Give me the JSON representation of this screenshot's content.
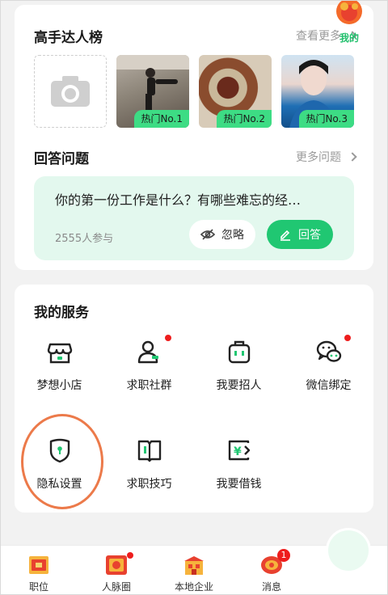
{
  "talent_ranking": {
    "title": "高手达人榜",
    "more_label": "查看更多",
    "items": [
      {
        "badge": "热门No.1"
      },
      {
        "badge": "热门No.2"
      },
      {
        "badge": "热门No.3"
      }
    ]
  },
  "questions": {
    "title": "回答问题",
    "more_label": "更多问题",
    "question": "你的第一份工作是什么？有哪些难忘的经…",
    "participants": "2555人参与",
    "ignore_label": "忽略",
    "answer_label": "回答"
  },
  "services": {
    "title": "我的服务",
    "items": [
      {
        "label": "梦想小店",
        "icon": "shop-icon"
      },
      {
        "label": "求职社群",
        "icon": "community-icon"
      },
      {
        "label": "我要招人",
        "icon": "recruit-icon"
      },
      {
        "label": "微信绑定",
        "icon": "wechat-icon"
      },
      {
        "label": "隐私设置",
        "icon": "privacy-shield-icon"
      },
      {
        "label": "求职技巧",
        "icon": "book-icon"
      },
      {
        "label": "我要借钱",
        "icon": "loan-icon"
      }
    ]
  },
  "bottom_nav": {
    "items": [
      {
        "label": "职位",
        "icon": "jobs-icon"
      },
      {
        "label": "人脉圈",
        "icon": "network-icon"
      },
      {
        "label": "本地企业",
        "icon": "local-company-icon"
      },
      {
        "label": "消息",
        "icon": "message-icon",
        "badge": "1"
      },
      {
        "label": "我的",
        "icon": "me-icon",
        "active": true
      }
    ]
  },
  "colors": {
    "accent": "#20c772",
    "badge_red": "#ee1d1d",
    "highlight_ring": "#ec7a4a"
  }
}
